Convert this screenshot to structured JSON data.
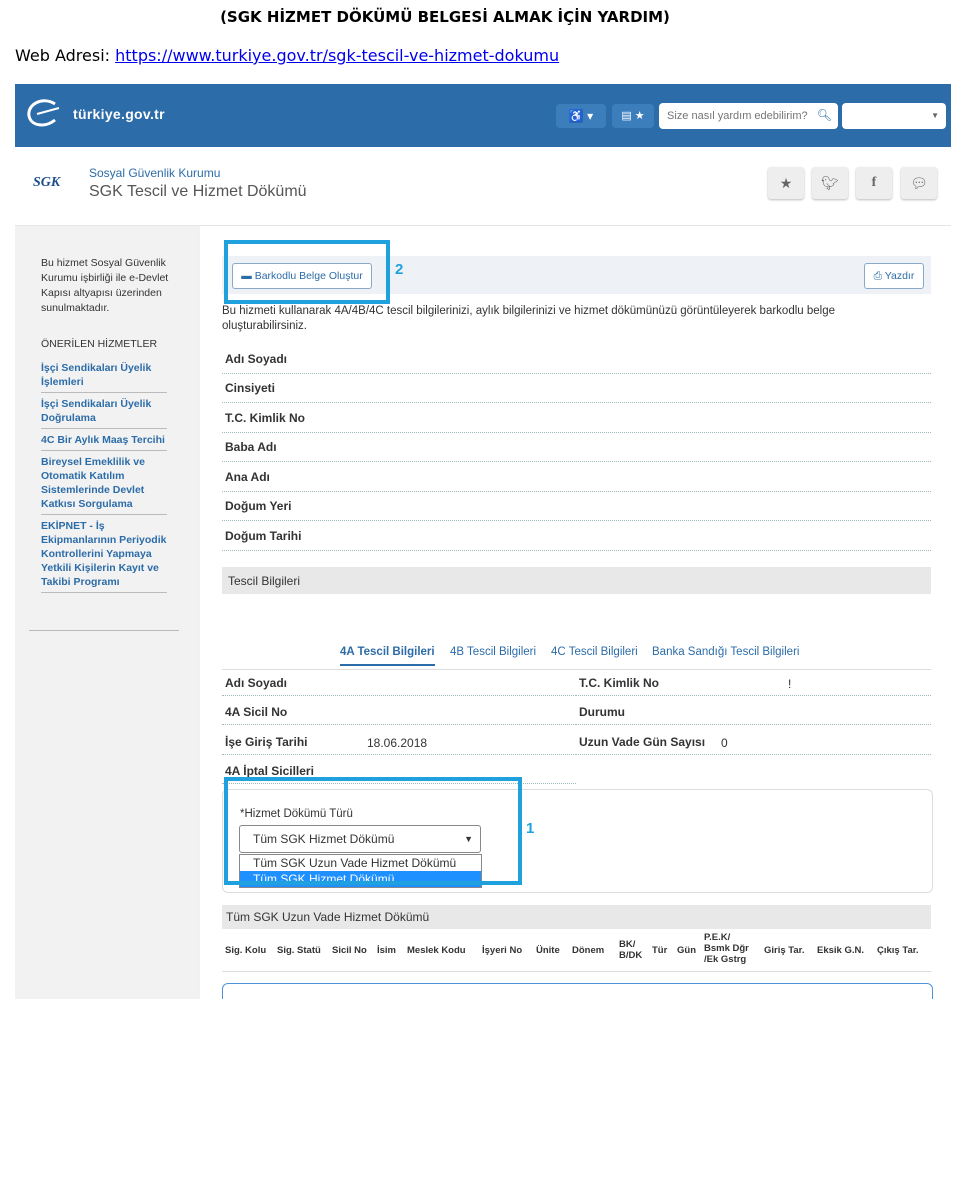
{
  "doc": {
    "title": "(SGK HİZMET DÖKÜMÜ BELGESİ ALMAK İÇİN YARDIM)",
    "web_label": "Web Adresi: ",
    "web_url": "https://www.turkiye.gov.tr/sgk-tescil-ve-hizmet-dokumu"
  },
  "topbar": {
    "logo": "türkiye.gov.tr",
    "accessibility_icon": "wheelchair-icon",
    "search_placeholder": "Size nasıl yardım edebilirim?",
    "bg_color": "#2c6ca8"
  },
  "header": {
    "sgk_logo": "SGK",
    "org": "Sosyal Güvenlik Kurumu",
    "title": "SGK Tescil ve Hizmet Dökümü"
  },
  "sidebar": {
    "info": "Bu hizmet Sosyal Güvenlik Kurumu işbirliği ile e-Devlet Kapısı altyapısı üzerinden sunulmaktadır.",
    "heading": "ÖNERİLEN HİZMETLER",
    "items": [
      "İşçi Sendikaları Üyelik İşlemleri",
      "İşçi Sendikaları Üyelik Doğrulama",
      "4C Bir Aylık Maaş Tercihi",
      "Bireysel Emeklilik ve Otomatik Katılım Sistemlerinde Devlet Katkısı Sorgulama",
      "EKİPNET - İş Ekipmanlarının Periyodik Kontrollerini Yapmaya Yetkili Kişilerin Kayıt ve Takibi Programı"
    ]
  },
  "toolbar": {
    "barcode_label": "Barkodlu Belge Oluştur",
    "print_label": "Yazdır",
    "callout_1": "1",
    "callout_2": "2",
    "highlight_color": "#1ea1dc"
  },
  "main": {
    "description": "Bu hizmeti kullanarak 4A/4B/4C tescil bilgilerinizi, aylık bilgilerinizi ve hizmet dökümünüzü görüntüleyerek barkodlu belge oluşturabilirsiniz.",
    "personal_fields": [
      "Adı Soyadı",
      "Cinsiyeti",
      "T.C. Kimlik No",
      "Baba Adı",
      "Ana Adı",
      "Doğum Yeri",
      "Doğum Tarihi"
    ],
    "section_title": "Tescil Bilgileri",
    "tabs": [
      "4A Tescil Bilgileri",
      "4B Tescil Bilgileri",
      "4C Tescil Bilgileri",
      "Banka Sandığı Tescil Bilgileri"
    ],
    "registration": {
      "name_label": "Adı Soyadı",
      "tc_label": "T.C. Kimlik No",
      "tc_value": "!",
      "sicil_label": "4A Sicil No",
      "status_label": "Durumu",
      "start_label": "İşe Giriş Tarihi",
      "start_value": "18.06.2018",
      "days_label": "Uzun Vade Gün Sayısı",
      "days_value": "0",
      "cancel_label": "4A İptal Sicilleri"
    },
    "service_type": {
      "label": "*Hizmet Dökümü Türü",
      "selected": "Tüm SGK Hizmet Dökümü",
      "options": [
        "Tüm SGK Uzun Vade Hizmet Dökümü",
        "Tüm SGK Hizmet Dökümü"
      ]
    },
    "table": {
      "title": "Tüm SGK Uzun Vade Hizmet Dökümü",
      "columns": [
        "Sig. Kolu",
        "Sig. Statü",
        "Sicil No",
        "İsim",
        "Meslek Kodu",
        "İşyeri No",
        "Ünite",
        "Dönem",
        "BK/ B/DK",
        "Tür",
        "Gün",
        "P.E.K/ Bsmk Dğr /Ek Gstrg",
        "Giriş Tar.",
        "Eksik G.N.",
        "Çıkış Tar."
      ]
    }
  }
}
